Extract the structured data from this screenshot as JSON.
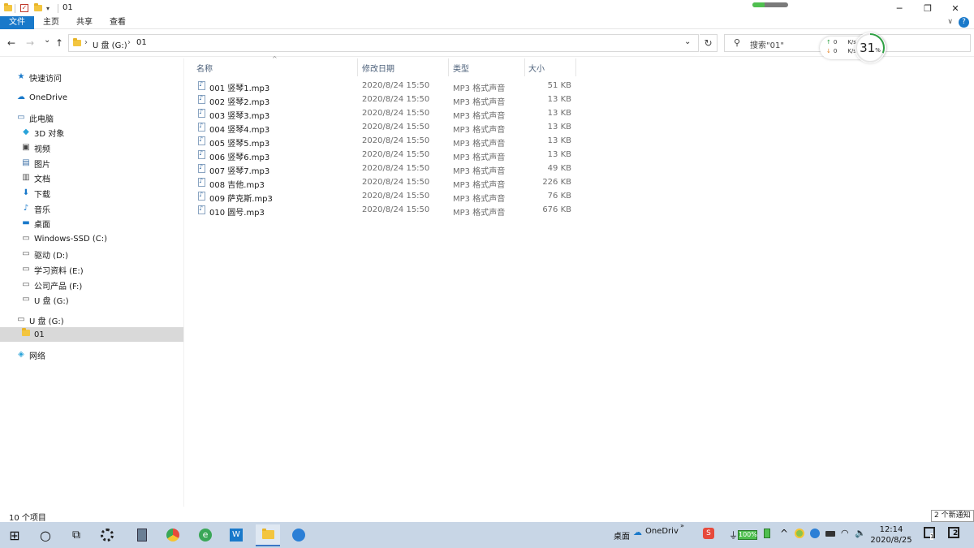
{
  "window": {
    "title": "01",
    "minimize_glyph": "─",
    "maximize_glyph": "❐",
    "close_glyph": "✕",
    "progress_fraction": 0.35
  },
  "ribbon": {
    "tabs": [
      "文件",
      "主页",
      "共享",
      "查看"
    ],
    "expand_glyph": "∨",
    "help_glyph": "?"
  },
  "address": {
    "back_glyph": "←",
    "forward_glyph": "→",
    "recent_glyph": "⌄",
    "up_glyph": "↑",
    "crumbs": [
      "U 盘 (G:)",
      "01"
    ],
    "crumb_sep": "›",
    "dropdown_glyph": "⌄",
    "refresh_glyph": "↻",
    "search_placeholder": "搜索\"01\"",
    "search_glyph": "⚲"
  },
  "net_widget": {
    "up_value": "0",
    "down_value": "0",
    "unit": "K/s",
    "up_arrow": "↑",
    "down_arrow": "↓",
    "cpu_percent": "31",
    "cpu_fraction": 0.31,
    "percent_sign": "%"
  },
  "sidebar": {
    "items": [
      {
        "label": "快速访问",
        "icon": "star-icon"
      },
      {
        "label": "OneDrive",
        "icon": "cloud-icon"
      },
      {
        "label": "此电脑",
        "icon": "computer-icon"
      },
      {
        "label": "3D 对象",
        "icon": "cube-icon"
      },
      {
        "label": "视频",
        "icon": "video-icon"
      },
      {
        "label": "图片",
        "icon": "picture-icon"
      },
      {
        "label": "文档",
        "icon": "document-icon"
      },
      {
        "label": "下载",
        "icon": "download-icon"
      },
      {
        "label": "音乐",
        "icon": "music-icon"
      },
      {
        "label": "桌面",
        "icon": "desktop-icon"
      },
      {
        "label": "Windows-SSD (C:)",
        "icon": "drive-icon"
      },
      {
        "label": "驱动 (D:)",
        "icon": "drive-icon"
      },
      {
        "label": "学习资料 (E:)",
        "icon": "drive-icon"
      },
      {
        "label": "公司产品 (F:)",
        "icon": "drive-icon"
      },
      {
        "label": "U 盘 (G:)",
        "icon": "drive-icon"
      },
      {
        "label": "U 盘 (G:)",
        "icon": "usb-drive-icon"
      },
      {
        "label": "01",
        "icon": "folder-icon"
      },
      {
        "label": "网络",
        "icon": "network-icon"
      }
    ]
  },
  "list": {
    "columns": [
      "名称",
      "修改日期",
      "类型",
      "大小"
    ],
    "sort_glyph": "^",
    "rows": [
      {
        "name": "001 竖琴1.mp3",
        "date": "2020/8/24 15:50",
        "type": "MP3 格式声音",
        "size": "51 KB"
      },
      {
        "name": "002 竖琴2.mp3",
        "date": "2020/8/24 15:50",
        "type": "MP3 格式声音",
        "size": "13 KB"
      },
      {
        "name": "003 竖琴3.mp3",
        "date": "2020/8/24 15:50",
        "type": "MP3 格式声音",
        "size": "13 KB"
      },
      {
        "name": "004 竖琴4.mp3",
        "date": "2020/8/24 15:50",
        "type": "MP3 格式声音",
        "size": "13 KB"
      },
      {
        "name": "005 竖琴5.mp3",
        "date": "2020/8/24 15:50",
        "type": "MP3 格式声音",
        "size": "13 KB"
      },
      {
        "name": "006 竖琴6.mp3",
        "date": "2020/8/24 15:50",
        "type": "MP3 格式声音",
        "size": "13 KB"
      },
      {
        "name": "007 竖琴7.mp3",
        "date": "2020/8/24 15:50",
        "type": "MP3 格式声音",
        "size": "49 KB"
      },
      {
        "name": "008 吉他.mp3",
        "date": "2020/8/24 15:50",
        "type": "MP3 格式声音",
        "size": "226 KB"
      },
      {
        "name": "009 萨克斯.mp3",
        "date": "2020/8/24 15:50",
        "type": "MP3 格式声音",
        "size": "76 KB"
      },
      {
        "name": "010 圆号.mp3",
        "date": "2020/8/24 15:50",
        "type": "MP3 格式声音",
        "size": "676 KB"
      }
    ]
  },
  "status": {
    "count": "10 个项目",
    "notification_tip": "2 个新通知"
  },
  "taskbar": {
    "start_glyph": "⊞",
    "search_glyph": "○",
    "taskview_glyph": "⧉",
    "desktop_label": "桌面",
    "onedrive_label": "OneDriv",
    "overflow_glyph": "»",
    "battery_label": "100%",
    "chevron_glyph": "^",
    "volume_glyph": "🔈",
    "time": "12:14",
    "date": "2020/8/25",
    "action_badge": "2",
    "desktop_badge": "1"
  },
  "colors": {
    "accent": "#1979ca",
    "taskbar": "#c8d6e6",
    "selected": "#d9d9d9",
    "folder": "#f3c53f"
  }
}
